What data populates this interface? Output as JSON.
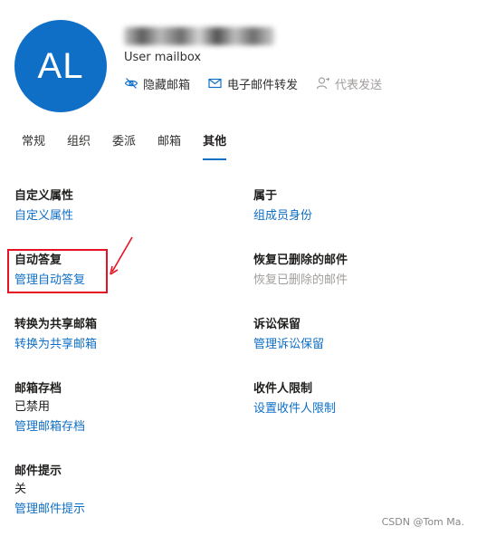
{
  "header": {
    "avatar_initials": "AL",
    "subtitle": "User mailbox",
    "actions": [
      {
        "label": "隐藏邮箱",
        "icon": "hide-eye-icon"
      },
      {
        "label": "电子邮件转发",
        "icon": "mail-forward-icon"
      },
      {
        "label": "代表发送",
        "icon": "person-send-icon",
        "disabled": true
      }
    ]
  },
  "tabs": [
    {
      "label": "常规"
    },
    {
      "label": "组织"
    },
    {
      "label": "委派"
    },
    {
      "label": "邮箱"
    },
    {
      "label": "其他",
      "active": true
    }
  ],
  "sections": {
    "custom_attributes": {
      "title": "自定义属性",
      "link": "自定义属性"
    },
    "member_of": {
      "title": "属于",
      "link": "组成员身份"
    },
    "auto_reply": {
      "title": "自动答复",
      "link": "管理自动答复"
    },
    "recover_deleted": {
      "title": "恢复已删除的邮件",
      "link": "恢复已删除的邮件"
    },
    "convert_shared": {
      "title": "转换为共享邮箱",
      "link": "转换为共享邮箱"
    },
    "litigation_hold": {
      "title": "诉讼保留",
      "link": "管理诉讼保留"
    },
    "mailbox_archive": {
      "title": "邮箱存档",
      "value": "已禁用",
      "link": "管理邮箱存档"
    },
    "recipient_limits": {
      "title": "收件人限制",
      "link": "设置收件人限制"
    },
    "mail_tips": {
      "title": "邮件提示",
      "value": "关",
      "link": "管理邮件提示"
    }
  },
  "watermark": "CSDN @Tom Ma.",
  "colors": {
    "accent": "#0f6fc6",
    "highlight": "#e81123",
    "disabled": "#a19f9d"
  }
}
